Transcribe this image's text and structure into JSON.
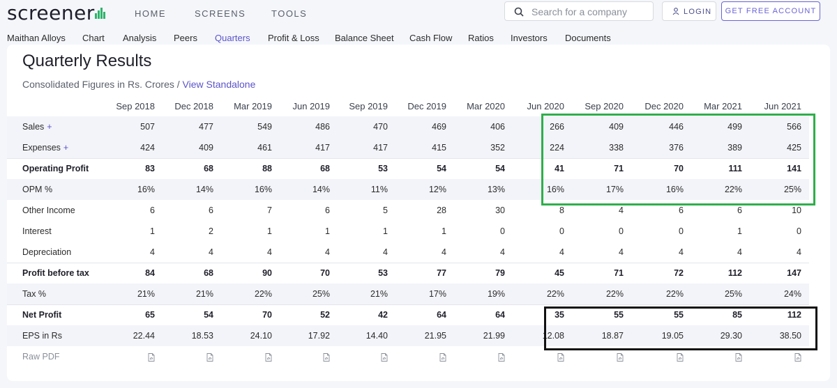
{
  "header": {
    "logo_text": "screener",
    "nav": [
      "HOME",
      "SCREENS",
      "TOOLS"
    ],
    "search_placeholder": "Search for a company",
    "login_label": "LOGIN",
    "account_label": "GET FREE ACCOUNT"
  },
  "subnav": {
    "items": [
      "Maithan Alloys",
      "Chart",
      "Analysis",
      "Peers",
      "Quarters",
      "Profit & Loss",
      "Balance Sheet",
      "Cash Flow",
      "Ratios",
      "Investors",
      "Documents"
    ],
    "active": "Quarters"
  },
  "section": {
    "title": "Quarterly Results",
    "subtitle": "Consolidated Figures in Rs. Crores / ",
    "link": "View Standalone"
  },
  "table": {
    "columns": [
      "Sep 2018",
      "Dec 2018",
      "Mar 2019",
      "Jun 2019",
      "Sep 2019",
      "Dec 2019",
      "Mar 2020",
      "Jun 2020",
      "Sep 2020",
      "Dec 2020",
      "Mar 2021",
      "Jun 2021"
    ],
    "rows": [
      {
        "label": "Sales",
        "plus": "+",
        "values": [
          "507",
          "477",
          "549",
          "486",
          "470",
          "469",
          "406",
          "266",
          "409",
          "446",
          "499",
          "566"
        ]
      },
      {
        "label": "Expenses",
        "plus": "+",
        "values": [
          "424",
          "409",
          "461",
          "417",
          "417",
          "415",
          "352",
          "224",
          "338",
          "376",
          "389",
          "425"
        ]
      },
      {
        "label": "Operating Profit",
        "bold": true,
        "values": [
          "83",
          "68",
          "88",
          "68",
          "53",
          "54",
          "54",
          "41",
          "71",
          "70",
          "111",
          "141"
        ]
      },
      {
        "label": "OPM %",
        "values": [
          "16%",
          "14%",
          "16%",
          "14%",
          "11%",
          "12%",
          "13%",
          "16%",
          "17%",
          "16%",
          "22%",
          "25%"
        ]
      },
      {
        "label": "Other Income",
        "values": [
          "6",
          "6",
          "7",
          "6",
          "5",
          "28",
          "30",
          "8",
          "4",
          "6",
          "6",
          "10"
        ]
      },
      {
        "label": "Interest",
        "values": [
          "1",
          "2",
          "1",
          "1",
          "1",
          "1",
          "0",
          "0",
          "0",
          "0",
          "1",
          "0"
        ]
      },
      {
        "label": "Depreciation",
        "values": [
          "4",
          "4",
          "4",
          "4",
          "4",
          "4",
          "4",
          "4",
          "4",
          "4",
          "4",
          "4"
        ]
      },
      {
        "label": "Profit before tax",
        "bold": true,
        "values": [
          "84",
          "68",
          "90",
          "70",
          "53",
          "77",
          "79",
          "45",
          "71",
          "72",
          "112",
          "147"
        ]
      },
      {
        "label": "Tax %",
        "values": [
          "21%",
          "21%",
          "22%",
          "25%",
          "21%",
          "17%",
          "19%",
          "22%",
          "22%",
          "22%",
          "25%",
          "24%"
        ]
      },
      {
        "label": "Net Profit",
        "bold": true,
        "values": [
          "65",
          "54",
          "70",
          "52",
          "42",
          "64",
          "64",
          "35",
          "55",
          "55",
          "85",
          "112"
        ]
      },
      {
        "label": "EPS in Rs",
        "values": [
          "22.44",
          "18.53",
          "24.10",
          "17.92",
          "14.40",
          "21.95",
          "21.99",
          "12.08",
          "18.87",
          "19.05",
          "29.30",
          "38.50"
        ]
      }
    ],
    "raw_pdf_label": "Raw PDF"
  },
  "colors": {
    "accent": "#5b53c9",
    "highlight_green": "#2fae4a",
    "highlight_black": "#111111"
  }
}
